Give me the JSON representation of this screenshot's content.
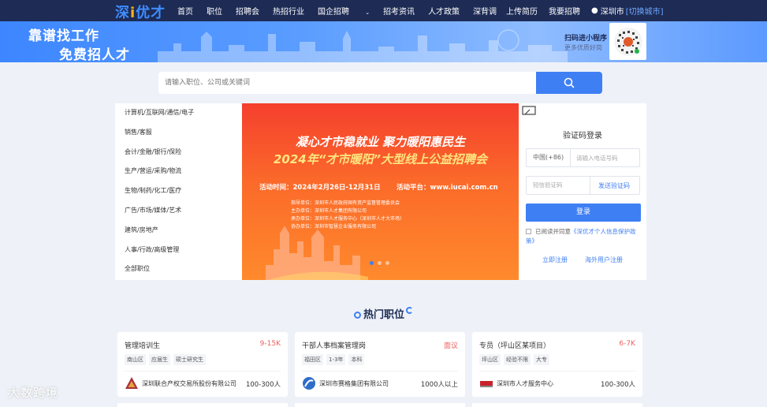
{
  "logo": {
    "main": "深",
    "accent": "i",
    "rest": "优才"
  },
  "nav": {
    "items": [
      "首页",
      "职位",
      "招聘会",
      "热招行业",
      "国企招聘",
      "招考资讯",
      "人才政策",
      "深背调"
    ],
    "upload": "上传简历",
    "hire": "我要招聘",
    "city": "深圳市",
    "switch_city": "[切换城市]"
  },
  "banner": {
    "slogan1": "靠谱找工作",
    "slogan2": "免费招人才",
    "mp_title": "扫码进小程序",
    "mp_sub": "更多优质好岗"
  },
  "search": {
    "placeholder": "请输入职位、公司或关键词"
  },
  "categories": [
    "计算机/互联网/通信/电子",
    "销售/客服",
    "会计/金融/银行/保险",
    "生产/营运/采购/物流",
    "生物/制药/化工/医疗",
    "广告/市场/媒体/艺术",
    "建筑/房地产",
    "人事/行政/高级管理",
    "全部职位"
  ],
  "promo": {
    "line1": "凝心才市稳就业 聚力暖阳惠民生",
    "line2": "2024年“才市暖阳”大型线上公益招聘会",
    "time": "活动时间：2024年2月26日-12月31日",
    "platform": "活动平台：www.iucai.com.cn",
    "orgs": [
      "指导单位：深圳市人民政府国有资产监督管理委员会",
      "主办单位：深圳市人才集团有限公司",
      "承办单位：深圳市人才服务中心（深圳市人才大市场）",
      "协办单位：深圳市智慧企业服务有限公司"
    ]
  },
  "login": {
    "title": "验证码登录",
    "country_code": "中国(+86)",
    "phone_placeholder": "请输入电话号码",
    "code_placeholder": "短信验证码",
    "send_code": "发送验证码",
    "login_button": "登录",
    "agree_prefix": "已阅读并同意",
    "policy": "《深优才个人信息保护政策》",
    "register": "立即注册",
    "overseas": "海外用户注册"
  },
  "hot": {
    "title": "热门职位",
    "jobs": [
      {
        "title": "管理培训生",
        "salary": "9-15K",
        "tags": [
          "南山区",
          "应届生",
          "硕士研究生"
        ],
        "company": "深圳联合产权交易所股份有限公司",
        "size": "100-300人"
      },
      {
        "title": "干部人事档案管理岗",
        "salary": "面议",
        "tags": [
          "福田区",
          "1-3年",
          "本科"
        ],
        "company": "深圳市赛格集团有限公司",
        "size": "1000人以上"
      },
      {
        "title": "专员（坪山区某项目）",
        "salary": "6-7K",
        "tags": [
          "坪山区",
          "经验不限",
          "大专"
        ],
        "company": "深圳市人才服务中心",
        "size": "100-300人"
      }
    ]
  },
  "watermark": "大数跨境",
  "colors": {
    "nav_bg": "#1d2b55",
    "primary": "#3f7ff4",
    "salary": "#f06060",
    "promo": "#f53f2e"
  }
}
